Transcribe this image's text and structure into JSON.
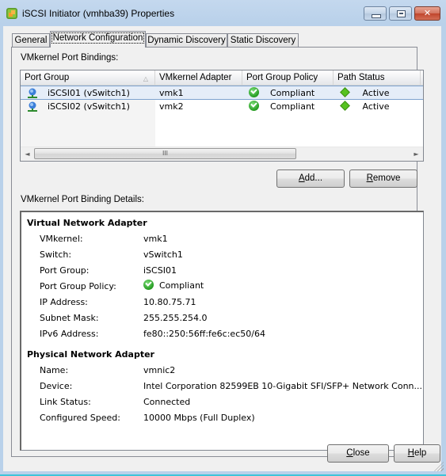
{
  "window": {
    "title": "iSCSI Initiator (vmhba39) Properties",
    "icon": "vsphere-app-icon",
    "controls": {
      "minimize": "minimize-icon",
      "maximize": "maximize-icon",
      "close": "close-icon"
    }
  },
  "tabs": [
    {
      "label": "General",
      "active": false
    },
    {
      "label": "Network Configuration",
      "active": true
    },
    {
      "label": "Dynamic Discovery",
      "active": false
    },
    {
      "label": "Static Discovery",
      "active": false
    }
  ],
  "bindings": {
    "section_label": "VMkernel Port Bindings:",
    "columns": [
      "Port Group",
      "VMkernel Adapter",
      "Port Group Policy",
      "Path Status"
    ],
    "sort_indicator": "△",
    "rows": [
      {
        "port_group": "iSCSI01 (vSwitch1)",
        "adapter": "vmk1",
        "policy": "Compliant",
        "status": "Active",
        "selected": true
      },
      {
        "port_group": "iSCSI02 (vSwitch1)",
        "adapter": "vmk2",
        "policy": "Compliant",
        "status": "Active",
        "selected": false
      }
    ],
    "scroll": {
      "left": "◄",
      "right": "►",
      "thumb_grip": "III"
    },
    "add_label": "Add...",
    "remove_label": "Remove",
    "add_accel": "A",
    "remove_accel": "R"
  },
  "details": {
    "section_label": "VMkernel Port Binding Details:",
    "virtual": {
      "title": "Virtual Network Adapter",
      "fields": [
        {
          "label": "VMkernel:",
          "value": "vmk1"
        },
        {
          "label": "Switch:",
          "value": "vSwitch1"
        },
        {
          "label": "Port Group:",
          "value": "iSCSI01"
        },
        {
          "label": "Port Group Policy:",
          "value": "Compliant"
        },
        {
          "label": "IP Address:",
          "value": "10.80.75.71"
        },
        {
          "label": "Subnet Mask:",
          "value": "255.255.254.0"
        },
        {
          "label": "IPv6 Address:",
          "value": "fe80::250:56ff:fe6c:ec50/64"
        }
      ]
    },
    "physical": {
      "title": "Physical Network Adapter",
      "fields": [
        {
          "label": "Name:",
          "value": "vmnic2"
        },
        {
          "label": "Device:",
          "value": "Intel Corporation 82599EB 10-Gigabit SFI/SFP+ Network Conn..."
        },
        {
          "label": "Link Status:",
          "value": "Connected"
        },
        {
          "label": "Configured Speed:",
          "value": "10000 Mbps (Full Duplex)"
        }
      ]
    }
  },
  "footer": {
    "close_label": "Close",
    "help_label": "Help"
  }
}
